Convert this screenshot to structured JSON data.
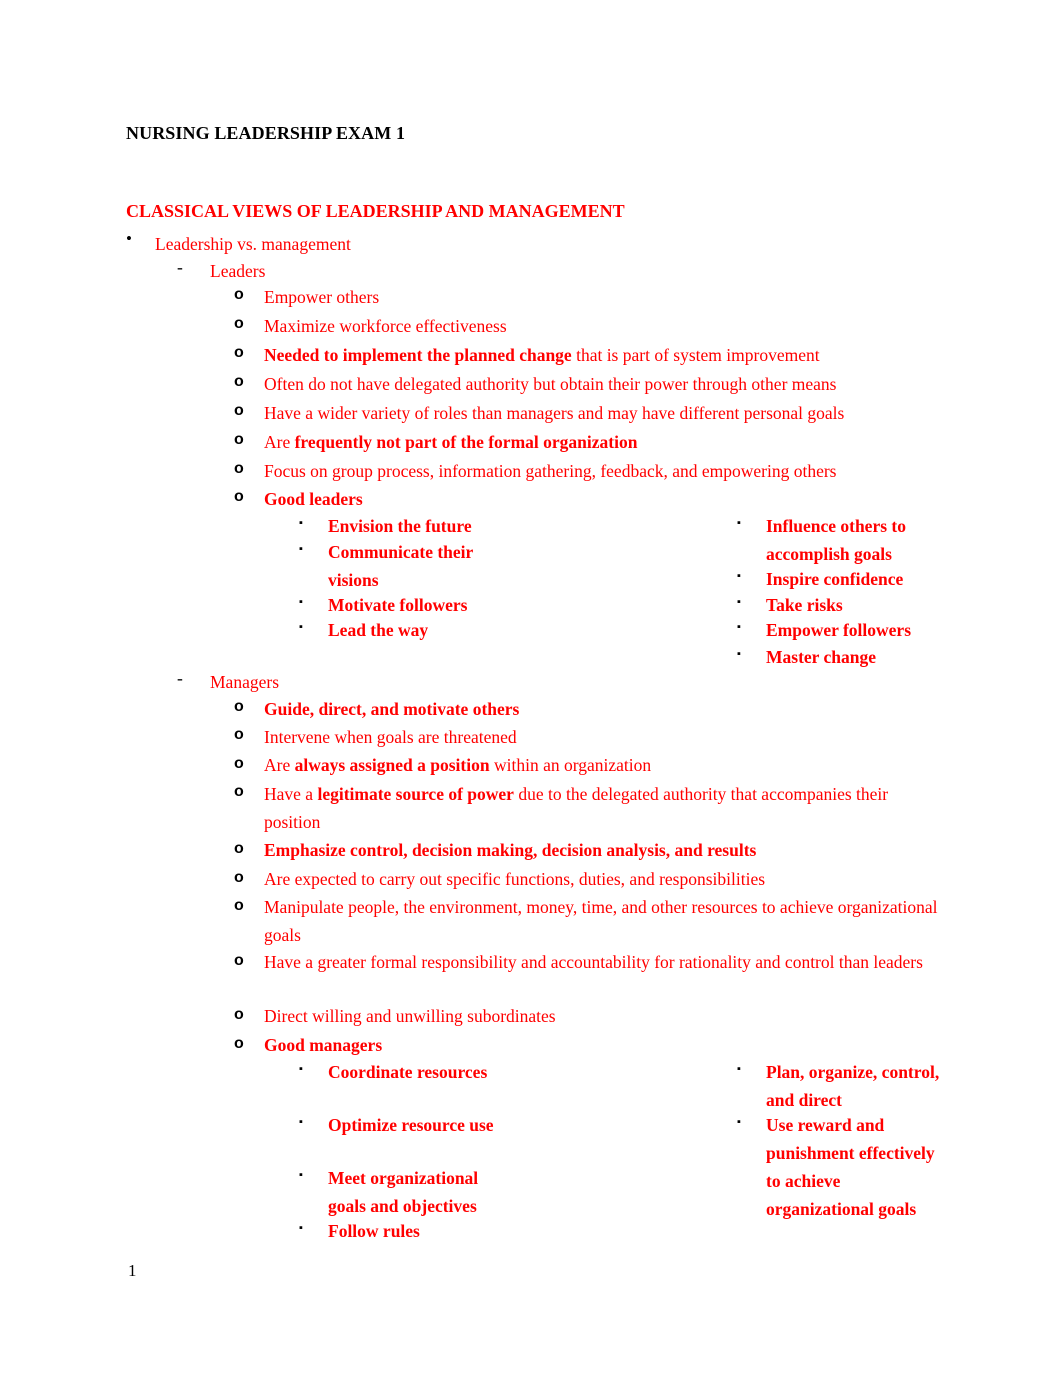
{
  "document": {
    "title": "NURSING LEADERSHIP EXAM 1",
    "page_number": "1",
    "text_color": "#ff0000",
    "heading_color": "#000000",
    "marker_color": "#000000"
  },
  "section": {
    "heading": "CLASSICAL VIEWS OF LEADERSHIP AND MANAGEMENT",
    "topic": "Leadership vs. management"
  },
  "leaders": {
    "label": "Leaders",
    "items": [
      {
        "plain_before": "Empower others",
        "bold": "",
        "plain_after": ""
      },
      {
        "plain_before": "Maximize workforce effectiveness",
        "bold": "",
        "plain_after": ""
      },
      {
        "plain_before": "",
        "bold": "Needed to implement the planned change",
        "plain_after": " that is part of system improvement"
      },
      {
        "plain_before": "Often do not have delegated authority but obtain their power through other means",
        "bold": "",
        "plain_after": ""
      },
      {
        "plain_before": "Have a wider variety of roles than managers and may have different personal goals",
        "bold": "",
        "plain_after": ""
      },
      {
        "plain_before": "Are ",
        "bold": "frequently not part of the formal organization",
        "plain_after": ""
      },
      {
        "plain_before": "Focus on group process, information gathering, feedback, and empowering others",
        "bold": "",
        "plain_after": ""
      }
    ],
    "good_leaders_label": "Good leaders",
    "good_leaders_left": [
      "Envision the future",
      "Communicate their visions",
      "Motivate followers",
      "Lead the way"
    ],
    "good_leaders_right": [
      "Influence others to accomplish goals",
      "Inspire confidence",
      "Take risks",
      "Empower followers",
      "Master change"
    ]
  },
  "managers": {
    "label": "Managers",
    "items": [
      {
        "plain_before": "",
        "bold": "Guide, direct, and motivate others",
        "plain_after": ""
      },
      {
        "plain_before": "Intervene when goals are threatened",
        "bold": "",
        "plain_after": ""
      },
      {
        "plain_before": "Are ",
        "bold": "always assigned a position",
        "plain_after": " within an organization"
      },
      {
        "plain_before": "Have a ",
        "bold": "legitimate source of power",
        "plain_after": " due to the delegated authority that accompanies their position"
      },
      {
        "plain_before": "",
        "bold": "Emphasize control, decision making, decision analysis, and results",
        "plain_after": ""
      },
      {
        "plain_before": "Are expected to carry out specific functions, duties, and responsibilities",
        "bold": "",
        "plain_after": ""
      },
      {
        "plain_before": "Manipulate people, the environment, money, time, and other resources to achieve organizational goals",
        "bold": "",
        "plain_after": ""
      },
      {
        "plain_before": "Have a greater formal responsibility and accountability for rationality and control than leaders",
        "bold": "",
        "plain_after": ""
      },
      {
        "plain_before": "Direct willing and unwilling subordinates",
        "bold": "",
        "plain_after": ""
      }
    ],
    "good_managers_label": "Good managers",
    "good_managers_left": [
      "Coordinate resources",
      "Optimize resource use",
      "Meet organizational goals and objectives",
      "Follow rules"
    ],
    "good_managers_right": [
      "Plan, organize, control, and direct",
      "Use reward and punishment effectively to achieve organizational goals"
    ]
  },
  "markers": {
    "level1": "•",
    "level2": "-",
    "level3": "o",
    "level4": "▪"
  }
}
